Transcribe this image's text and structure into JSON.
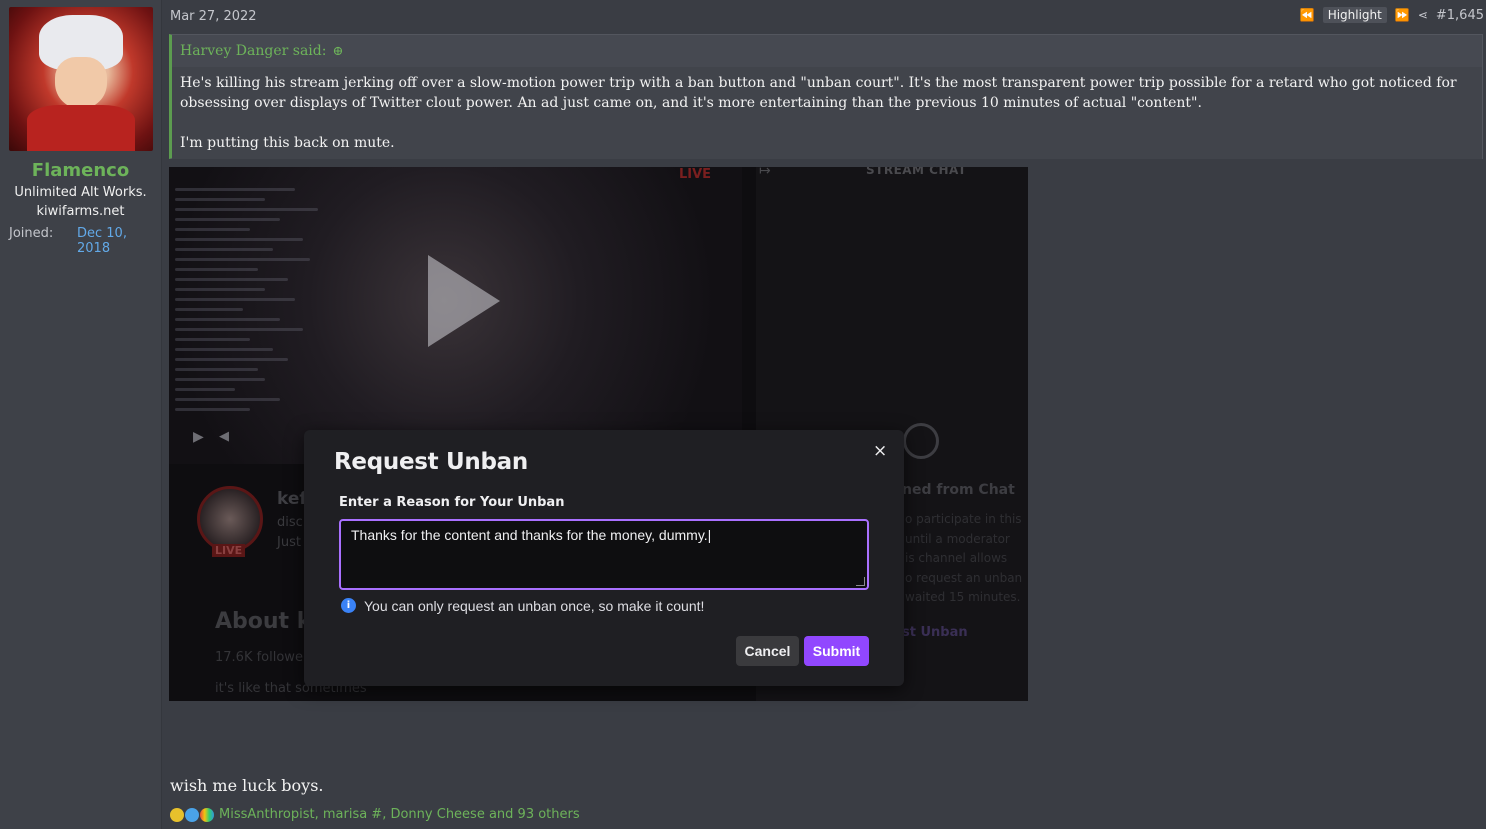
{
  "user": {
    "name": "Flamenco",
    "title_line1": "Unlimited Alt Works.",
    "title_line2": "kiwifarms.net",
    "joined_label": "Joined:",
    "joined_date": "Dec 10, 2018"
  },
  "post": {
    "date": "Mar 27, 2022",
    "highlight_label": "Highlight",
    "post_number": "#1,645",
    "body_text": "wish me luck boys.",
    "reactions_text": "MissAnthropist, marisa #, Donny Cheese and 93 others"
  },
  "quote": {
    "author": "Harvey Danger said:",
    "paragraph1": "He's killing his stream jerking off over a slow-motion power trip with a ban button and \"unban court\". It's the most transparent power trip possible for a retard who got noticed for obsessing over displays of Twitter clout power. An ad just came on, and it's more entertaining than the previous 10 minutes of actual \"content\".",
    "paragraph2": "I'm putting this back on mute."
  },
  "embed": {
    "live_badge": "LIVE",
    "stream_chat_label": "STREAM CHAT",
    "channel_live": "LIVE",
    "channel_name": "kef",
    "channel_sub1": "disc",
    "channel_sub2": "Just",
    "about_heading": "About k",
    "followers": "17.6K followe",
    "about_text": "it's like that sometimes",
    "banned_heading": "ned from Chat",
    "banned_lines": [
      "o participate in this",
      "until a moderator",
      "is channel allows",
      "o request an unban",
      "waited 15 minutes."
    ],
    "request_unban_link": "st Unban"
  },
  "modal": {
    "title": "Request Unban",
    "label": "Enter a Reason for Your Unban",
    "textarea_value": "Thanks for the content and thanks for the money, dummy.",
    "info": "You can only request an unban once, so make it count!",
    "cancel_label": "Cancel",
    "submit_label": "Submit",
    "close_glyph": "×"
  },
  "colors": {
    "accent_green": "#6db35a",
    "twitch_purple": "#9147ff",
    "link_blue": "#62a9e8"
  }
}
